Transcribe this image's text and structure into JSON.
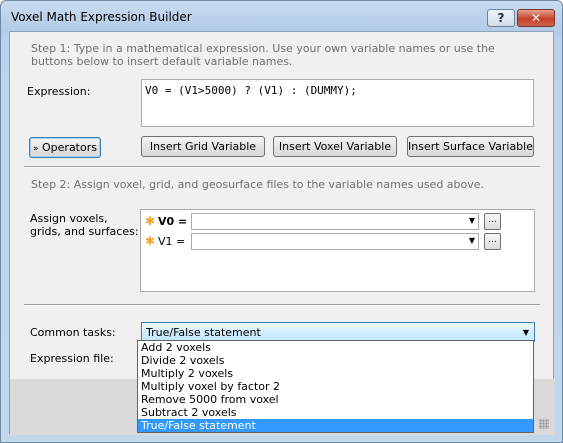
{
  "window": {
    "title": "Voxel Math Expression Builder",
    "help_label": "?",
    "close_label": "✕"
  },
  "step1": {
    "text": "Step 1: Type in a mathematical expression. Use your own variable names or use the buttons below to insert default variable names.",
    "expression_label": "Expression:",
    "expression_value": "V0 = (V1>5000) ? (V1) : (DUMMY);"
  },
  "buttons": {
    "operators": "Operators",
    "insert_grid": "Insert Grid Variable",
    "insert_voxel": "Insert Voxel Variable",
    "insert_surface": "Insert Surface Variable",
    "browse": "..."
  },
  "step2": {
    "text": "Step 2: Assign voxel, grid, and geosurface files to the variable names used above.",
    "assign_label": "Assign voxels, grids, and surfaces:",
    "variables": [
      {
        "name": "V0 =",
        "value": ""
      },
      {
        "name": "V1 =",
        "value": ""
      }
    ]
  },
  "common_tasks": {
    "label": "Common tasks:",
    "selected": "True/False statement",
    "options": [
      "Add 2 voxels",
      "Divide 2 voxels",
      "Multiply 2 voxels",
      "Multiply voxel by factor 2",
      "Remove 5000 from voxel",
      "Subtract 2 voxels",
      "True/False statement"
    ]
  },
  "expression_file": {
    "label": "Expression file:"
  },
  "colors": {
    "selection": "#3399ff",
    "required_star": "#f2a72a",
    "combo_focus": "#3c7fb1"
  }
}
